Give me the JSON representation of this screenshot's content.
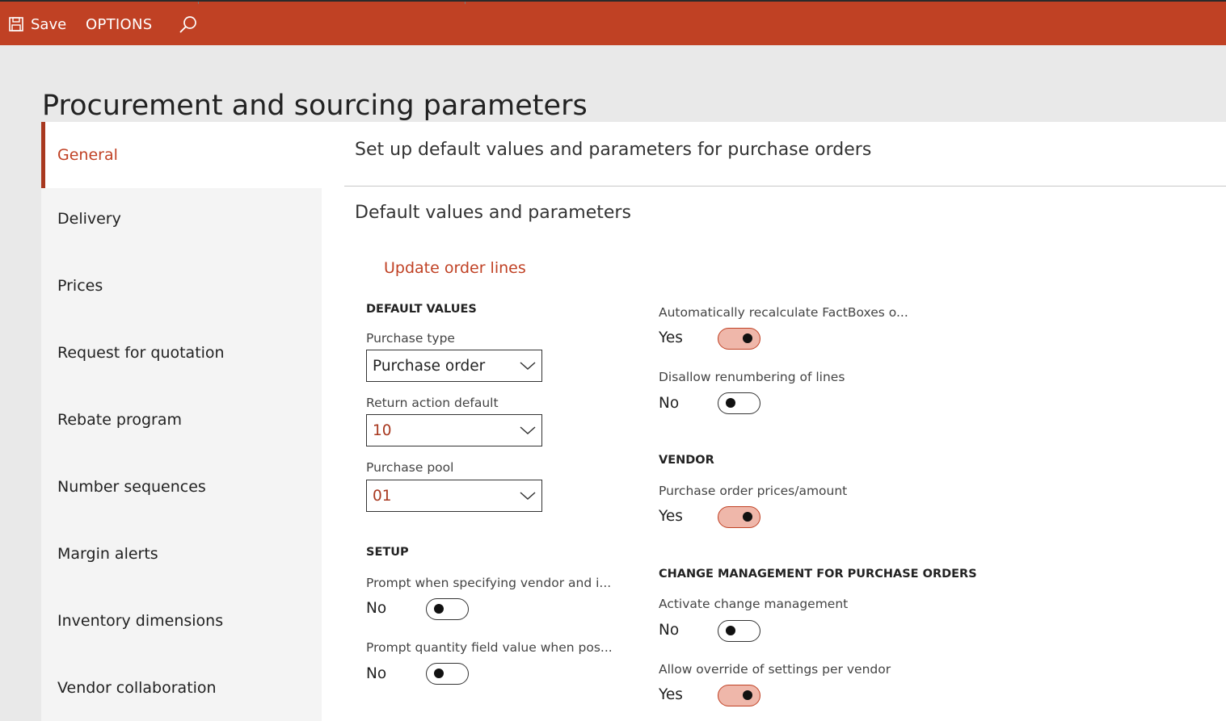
{
  "toolbar": {
    "save_label": "Save",
    "options_label": "OPTIONS",
    "save_icon": "save-icon",
    "search_icon": "search-icon"
  },
  "page": {
    "title": "Procurement and sourcing parameters"
  },
  "sidebar": {
    "items": [
      {
        "label": "General",
        "active": true
      },
      {
        "label": "Delivery"
      },
      {
        "label": "Prices"
      },
      {
        "label": "Request for quotation"
      },
      {
        "label": "Rebate program"
      },
      {
        "label": "Number sequences"
      },
      {
        "label": "Margin alerts"
      },
      {
        "label": "Inventory dimensions"
      },
      {
        "label": "Vendor collaboration"
      }
    ]
  },
  "main": {
    "header": "Set up default values and parameters for purchase orders",
    "section_title": "Default values and parameters",
    "update_link": "Update order lines",
    "default_values": {
      "heading": "DEFAULT VALUES",
      "purchase_type": {
        "label": "Purchase type",
        "value": "Purchase order"
      },
      "return_action": {
        "label": "Return action default",
        "value": "10"
      },
      "purchase_pool": {
        "label": "Purchase pool",
        "value": "01"
      }
    },
    "setup": {
      "heading": "SETUP",
      "prompt_vendor": {
        "label": "Prompt when specifying vendor and i...",
        "value": "No",
        "on": false
      },
      "prompt_quantity": {
        "label": "Prompt quantity field value when pos...",
        "value": "No",
        "on": false
      }
    },
    "factbox": {
      "recalc": {
        "label": "Automatically recalculate FactBoxes o...",
        "value": "Yes",
        "on": true
      },
      "disallow_renumber": {
        "label": "Disallow renumbering of lines",
        "value": "No",
        "on": false
      }
    },
    "vendor": {
      "heading": "VENDOR",
      "prices_amount": {
        "label": "Purchase order prices/amount",
        "value": "Yes",
        "on": true
      }
    },
    "change_mgmt": {
      "heading": "CHANGE MANAGEMENT FOR PURCHASE ORDERS",
      "activate": {
        "label": "Activate change management",
        "value": "No",
        "on": false
      },
      "override": {
        "label": "Allow override of settings per vendor",
        "value": "Yes",
        "on": true
      }
    }
  },
  "colors": {
    "accent": "#c04124",
    "toggle_on_fill": "#efb7aa"
  }
}
